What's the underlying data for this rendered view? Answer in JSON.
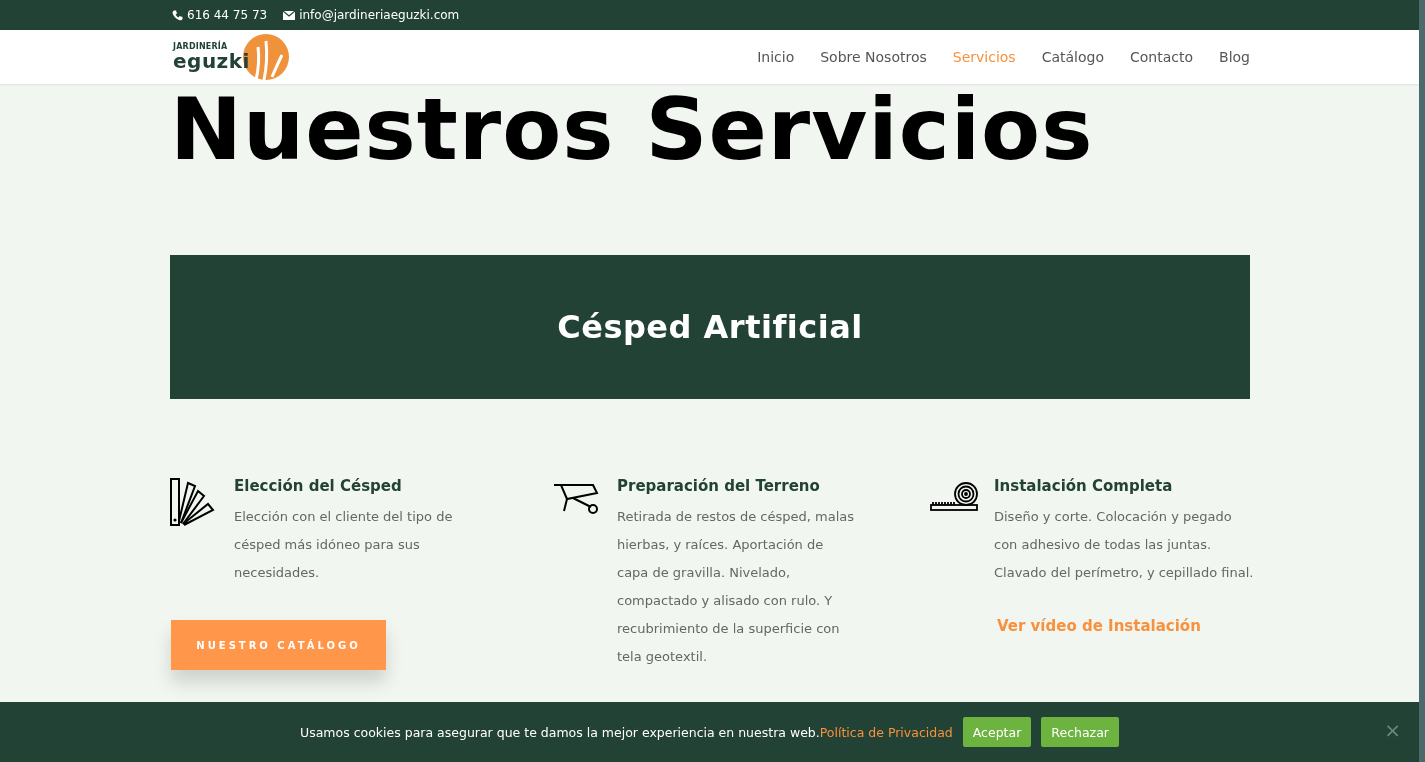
{
  "top_bar": {
    "phone": "616 44 75 73",
    "email": "info@jardineriaeguzki.com"
  },
  "logo": {
    "line_1": "JARDINERÍA",
    "line_2": "eguzki"
  },
  "nav": [
    {
      "label": "Inicio",
      "selected": false
    },
    {
      "label": "Sobre Nosotros",
      "selected": false
    },
    {
      "label": "Servicios",
      "selected": true
    },
    {
      "label": "Catálogo",
      "selected": false
    },
    {
      "label": "Contacto",
      "selected": false
    },
    {
      "label": "Blog",
      "selected": false
    }
  ],
  "page_title": "Nuestros Servicios",
  "banner_title": "Césped Artificial",
  "services": [
    {
      "kind": "swatch",
      "title": "Elección del Césped",
      "text": "Elección con el  cliente del tipo de césped más idóneo para sus necesidades.",
      "button": "NUESTRO CATÁLOGO"
    },
    {
      "kind": "wheelbarrow",
      "title": "Preparación del Terreno",
      "text": "Retirada de restos de césped, malas hierbas, y raíces. Aportación de capa de gravilla. Nivelado, compactado y alisado con rulo. Y recubrimiento de la superficie con tela geotextil."
    },
    {
      "kind": "roll",
      "title": "Instalación Completa",
      "text": "Diseño y corte. Colocación y pegado con adhesivo de todas las juntas. Clavado del perímetro, y cepillado final.",
      "link": "Ver vídeo de Instalación"
    }
  ],
  "cookie_bar": {
    "message": "Usamos cookies para asegurar que te damos la mejor experiencia en nuestra web.",
    "link": "Política de Privacidad",
    "buttons": [
      "Aceptar",
      "Rechazar"
    ],
    "close": "×"
  }
}
